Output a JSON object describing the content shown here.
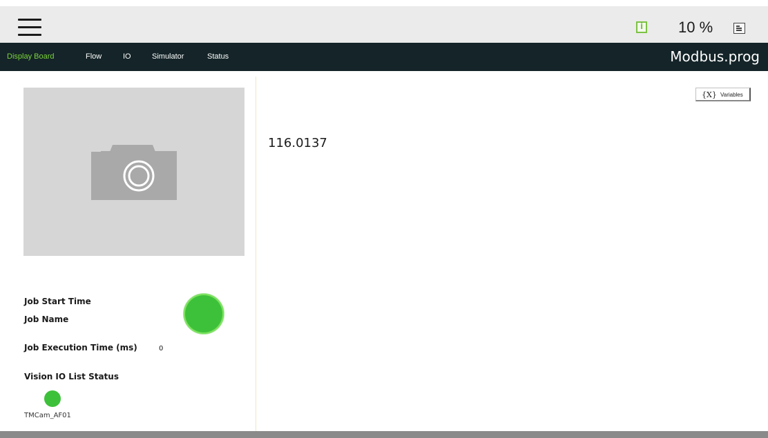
{
  "header": {
    "speed": "10 %",
    "icons": {
      "menu": "hamburger-menu-icon",
      "info": "info-icon",
      "log": "document-icon"
    },
    "colors": {
      "info_accent": "#7cc243"
    }
  },
  "nav": {
    "tabs": [
      {
        "label": "Display Board",
        "active": true
      },
      {
        "label": "Flow",
        "active": false
      },
      {
        "label": "IO",
        "active": false
      },
      {
        "label": "Simulator",
        "active": false
      },
      {
        "label": "Status",
        "active": false
      }
    ],
    "program_name": "Modbus.prog",
    "colors": {
      "background": "#142428",
      "active": "#7dd33c"
    }
  },
  "vision_panel": {
    "camera_icon": "camera-icon",
    "job_start_time_label": "Job Start Time",
    "job_name_label": "Job Name",
    "job_execution_time_label": "Job Execution Time (ms)",
    "job_execution_time_value": "0",
    "io_list_status_label": "Vision IO List Status",
    "camera_name": "TMCam_AF01",
    "status_color": "#3ec13a"
  },
  "display": {
    "variables_button": {
      "icon_text": "{X}",
      "label": "Variables"
    },
    "value": "116.0137"
  }
}
